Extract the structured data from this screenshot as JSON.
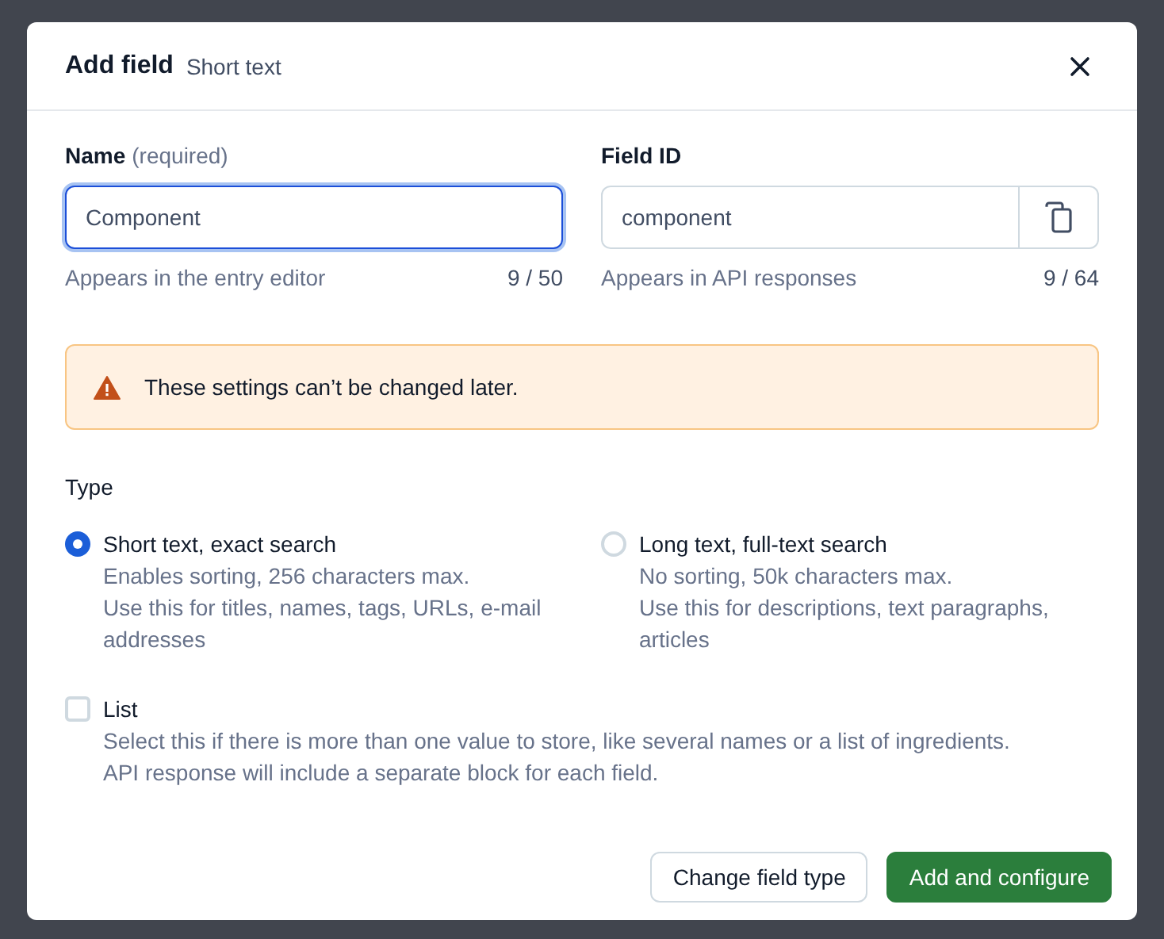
{
  "dialog": {
    "title": "Add field",
    "subtitle": "Short text"
  },
  "fields": [
    {
      "label": "Name",
      "hint": "(required)",
      "value": "Component",
      "focused": true,
      "help": "Appears in the entry editor",
      "count": "9 / 50",
      "copy_button": false
    },
    {
      "label": "Field ID",
      "value": "component",
      "focused": false,
      "help": "Appears in API responses",
      "count": "9 / 64",
      "copy_button": true
    }
  ],
  "alert": {
    "text": "These settings can’t be changed later."
  },
  "type_group": {
    "label": "Type",
    "options": [
      {
        "label": "Short text, exact search",
        "selected": true,
        "lines": [
          "Enables sorting, 256 characters max.",
          "Use this for titles, names, tags, URLs, e-mail addresses"
        ]
      },
      {
        "label": "Long text, full-text search",
        "selected": false,
        "lines": [
          "No sorting, 50k characters max.",
          "Use this for descriptions, text paragraphs, articles"
        ]
      }
    ]
  },
  "list_option": {
    "label": "List",
    "checked": false,
    "lines": [
      "Select this if there is more than one value to store, like several names or a list of ingredients.",
      "API response will include a separate block for each field."
    ]
  },
  "buttons": [
    {
      "label": "Change field type",
      "kind": "secondary"
    },
    {
      "label": "Add and configure",
      "kind": "primary"
    }
  ]
}
